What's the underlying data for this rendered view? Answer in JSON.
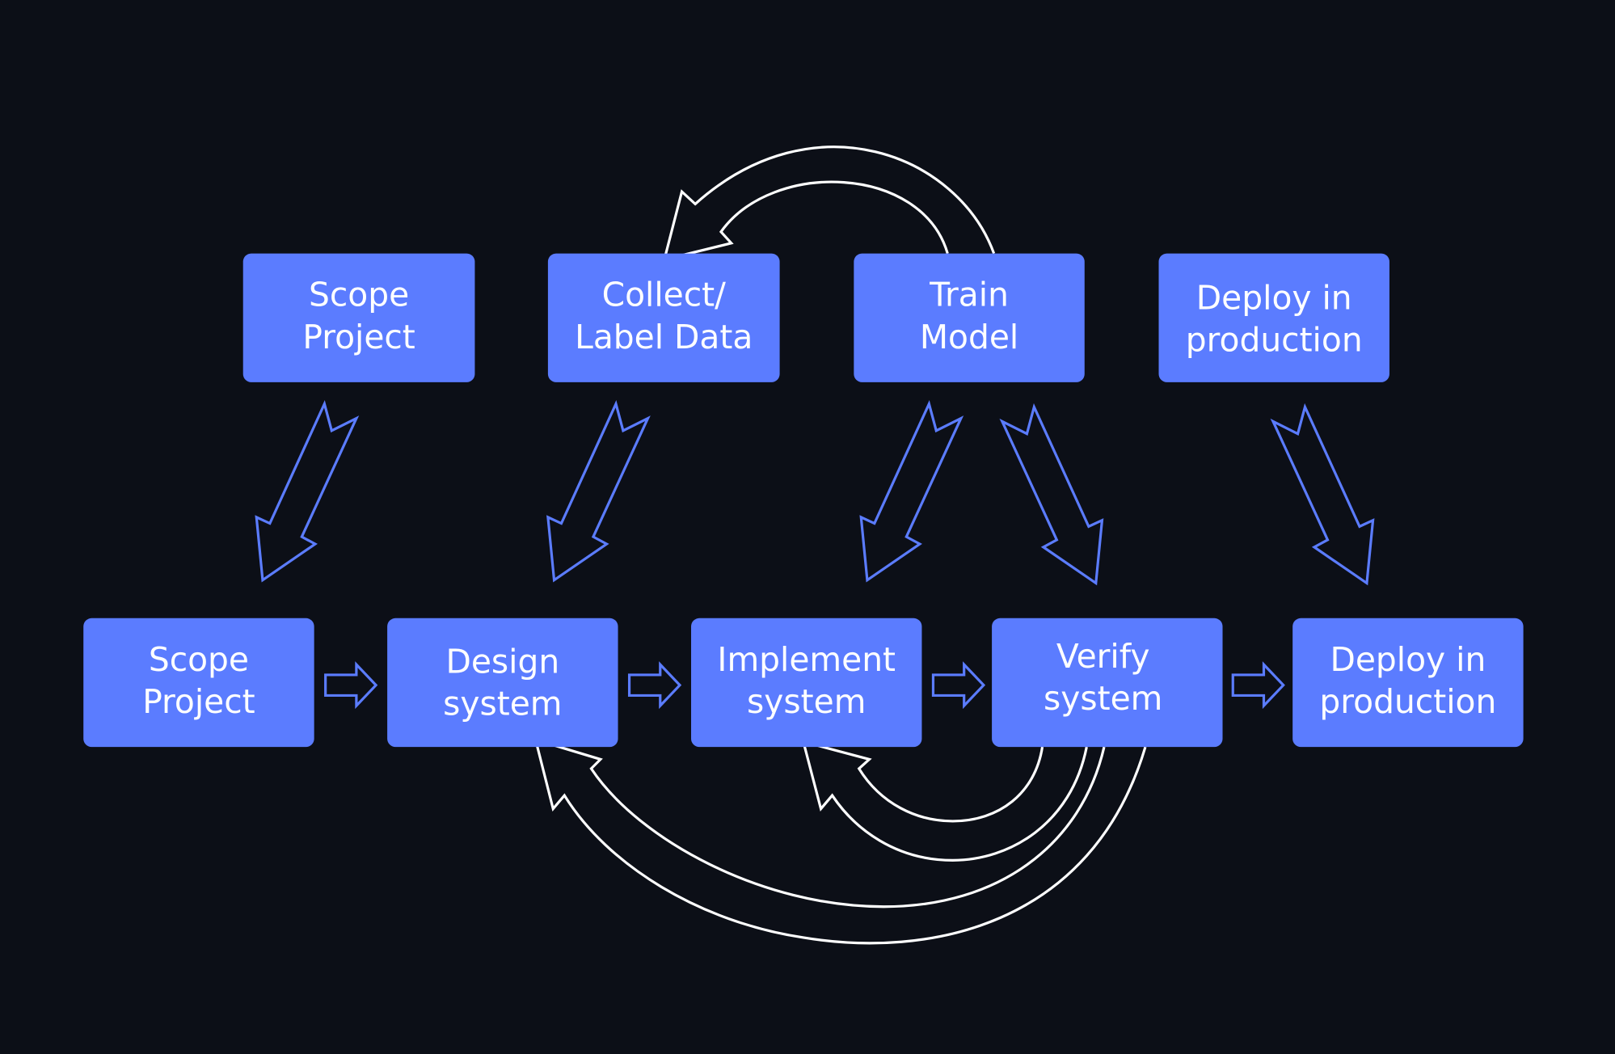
{
  "colors": {
    "background": "#0c0f17",
    "box": "#5b7cff",
    "flow_arrow": "#5b7cff",
    "feedback_arrow": "#ffffff",
    "text": "#ffffff"
  },
  "top_row": [
    {
      "lines": [
        "Scope",
        "Project"
      ]
    },
    {
      "lines": [
        "Collect/",
        "Label Data"
      ]
    },
    {
      "lines": [
        "Train",
        "Model"
      ]
    },
    {
      "lines": [
        "Deploy in",
        "production"
      ]
    }
  ],
  "bottom_row": [
    {
      "lines": [
        "Scope",
        "Project"
      ]
    },
    {
      "lines": [
        "Design",
        "system"
      ]
    },
    {
      "lines": [
        "Implement",
        "system"
      ]
    },
    {
      "lines": [
        "Verify",
        "system"
      ]
    },
    {
      "lines": [
        "Deploy in",
        "production"
      ]
    }
  ]
}
